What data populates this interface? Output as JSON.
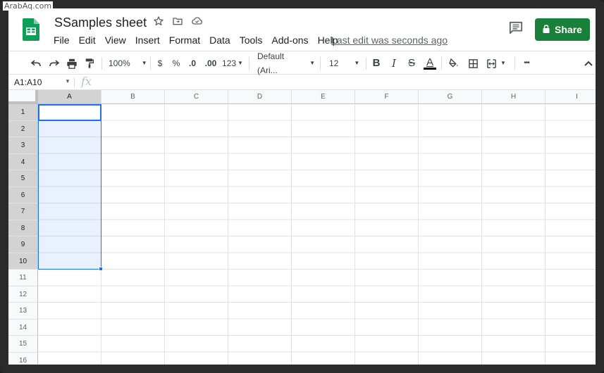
{
  "watermark": "ArabAq.com",
  "doc": {
    "title": "SSamples sheet",
    "last_edit": "Last edit was seconds ago"
  },
  "menu": [
    "File",
    "Edit",
    "View",
    "Insert",
    "Format",
    "Data",
    "Tools",
    "Add-ons",
    "Help"
  ],
  "share_label": "Share",
  "toolbar": {
    "zoom": "100%",
    "currency": "$",
    "percent": "%",
    "decrease_decimal": ".0",
    "increase_decimal": ".00",
    "more_formats": "123",
    "font": "Default (Ari...",
    "font_size": "12",
    "bold": "B",
    "italic": "I",
    "strike": "S",
    "text_color": "A",
    "more": "•••"
  },
  "formula_bar": {
    "name_box": "A1:A10",
    "fx": "fx"
  },
  "grid": {
    "columns": [
      "A",
      "B",
      "C",
      "D",
      "E",
      "F",
      "G",
      "H",
      "I"
    ],
    "rows": [
      "1",
      "2",
      "3",
      "4",
      "5",
      "6",
      "7",
      "8",
      "9",
      "10",
      "11",
      "12",
      "13",
      "14",
      "15",
      "16"
    ],
    "selected_range": "A1:A10"
  },
  "colors": {
    "brand_green": "#188038",
    "selection_blue": "#1a73e8"
  }
}
